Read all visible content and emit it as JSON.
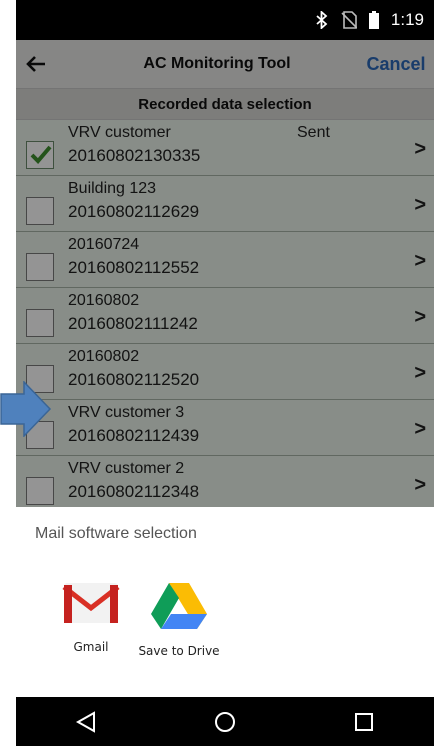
{
  "status_bar": {
    "time": "1:19",
    "icons": [
      "bluetooth-icon",
      "no-sim-icon",
      "battery-icon"
    ]
  },
  "header": {
    "back_icon": "back-arrow-icon",
    "title": "AC Monitoring Tool",
    "cancel_label": "Cancel"
  },
  "sub_header": {
    "title": "Recorded data selection"
  },
  "list": {
    "items": [
      {
        "name": "VRV customer",
        "date": "20160802130335",
        "status": "Sent",
        "checked": true
      },
      {
        "name": "Building 123",
        "date": "20160802112629",
        "status": "",
        "checked": false
      },
      {
        "name": "20160724",
        "date": "20160802112552",
        "status": "",
        "checked": false
      },
      {
        "name": "20160802",
        "date": "20160802111242",
        "status": "",
        "checked": false
      },
      {
        "name": "20160802",
        "date": "20160802112520",
        "status": "",
        "checked": false
      },
      {
        "name": "VRV customer 3",
        "date": "20160802112439",
        "status": "",
        "checked": false
      },
      {
        "name": "VRV customer 2",
        "date": "20160802112348",
        "status": "",
        "checked": false
      }
    ]
  },
  "sheet": {
    "title": "Mail software selection",
    "apps": [
      {
        "label": "Gmail",
        "icon": "gmail-icon"
      },
      {
        "label": "Save to Drive",
        "icon": "google-drive-icon"
      }
    ]
  },
  "nav_bar": {
    "icons": [
      "back-triangle-icon",
      "home-circle-icon",
      "recents-square-icon"
    ]
  },
  "colors": {
    "accent": "#2b68b8",
    "row_bg": "#eaf3ea",
    "arrow": "#4f81bd"
  }
}
